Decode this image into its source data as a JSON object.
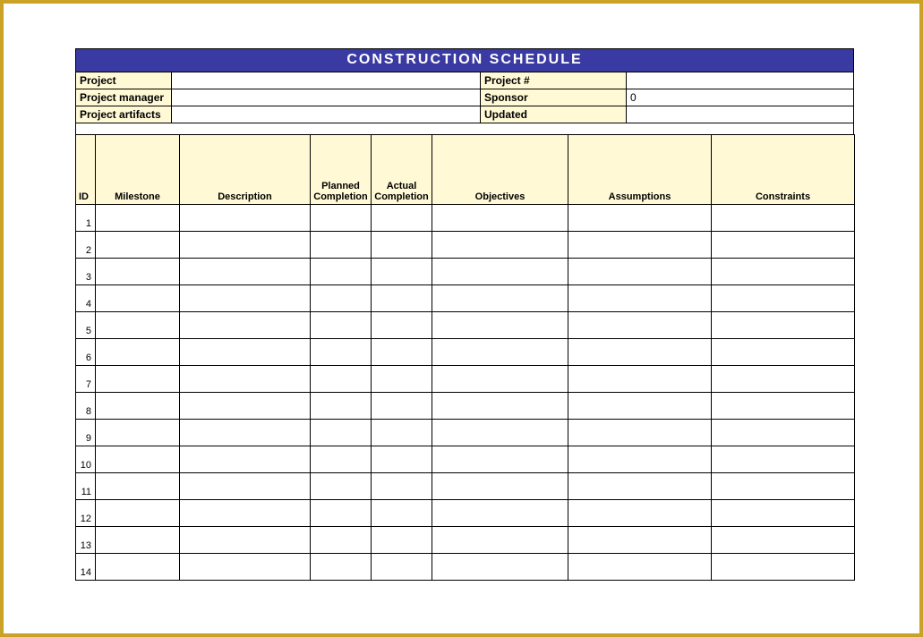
{
  "title": "CONSTRUCTION SCHEDULE",
  "meta": {
    "project_label": "Project",
    "project_value": "",
    "projectnum_label": "Project #",
    "projectnum_value": "",
    "manager_label": "Project manager",
    "manager_value": "",
    "sponsor_label": "Sponsor",
    "sponsor_value": "0",
    "artifacts_label": "Project artifacts",
    "artifacts_value": "",
    "updated_label": "Updated",
    "updated_value": ""
  },
  "columns": {
    "id": "ID",
    "milestone": "Milestone",
    "description": "Description",
    "planned": "Planned Completion",
    "actual": "Actual Completion",
    "objectives": "Objectives",
    "assumptions": "Assumptions",
    "constraints": "Constraints"
  },
  "rows": [
    {
      "id": "1"
    },
    {
      "id": "2"
    },
    {
      "id": "3"
    },
    {
      "id": "4"
    },
    {
      "id": "5"
    },
    {
      "id": "6"
    },
    {
      "id": "7"
    },
    {
      "id": "8"
    },
    {
      "id": "9"
    },
    {
      "id": "10"
    },
    {
      "id": "11"
    },
    {
      "id": "12"
    },
    {
      "id": "13"
    },
    {
      "id": "14"
    }
  ]
}
